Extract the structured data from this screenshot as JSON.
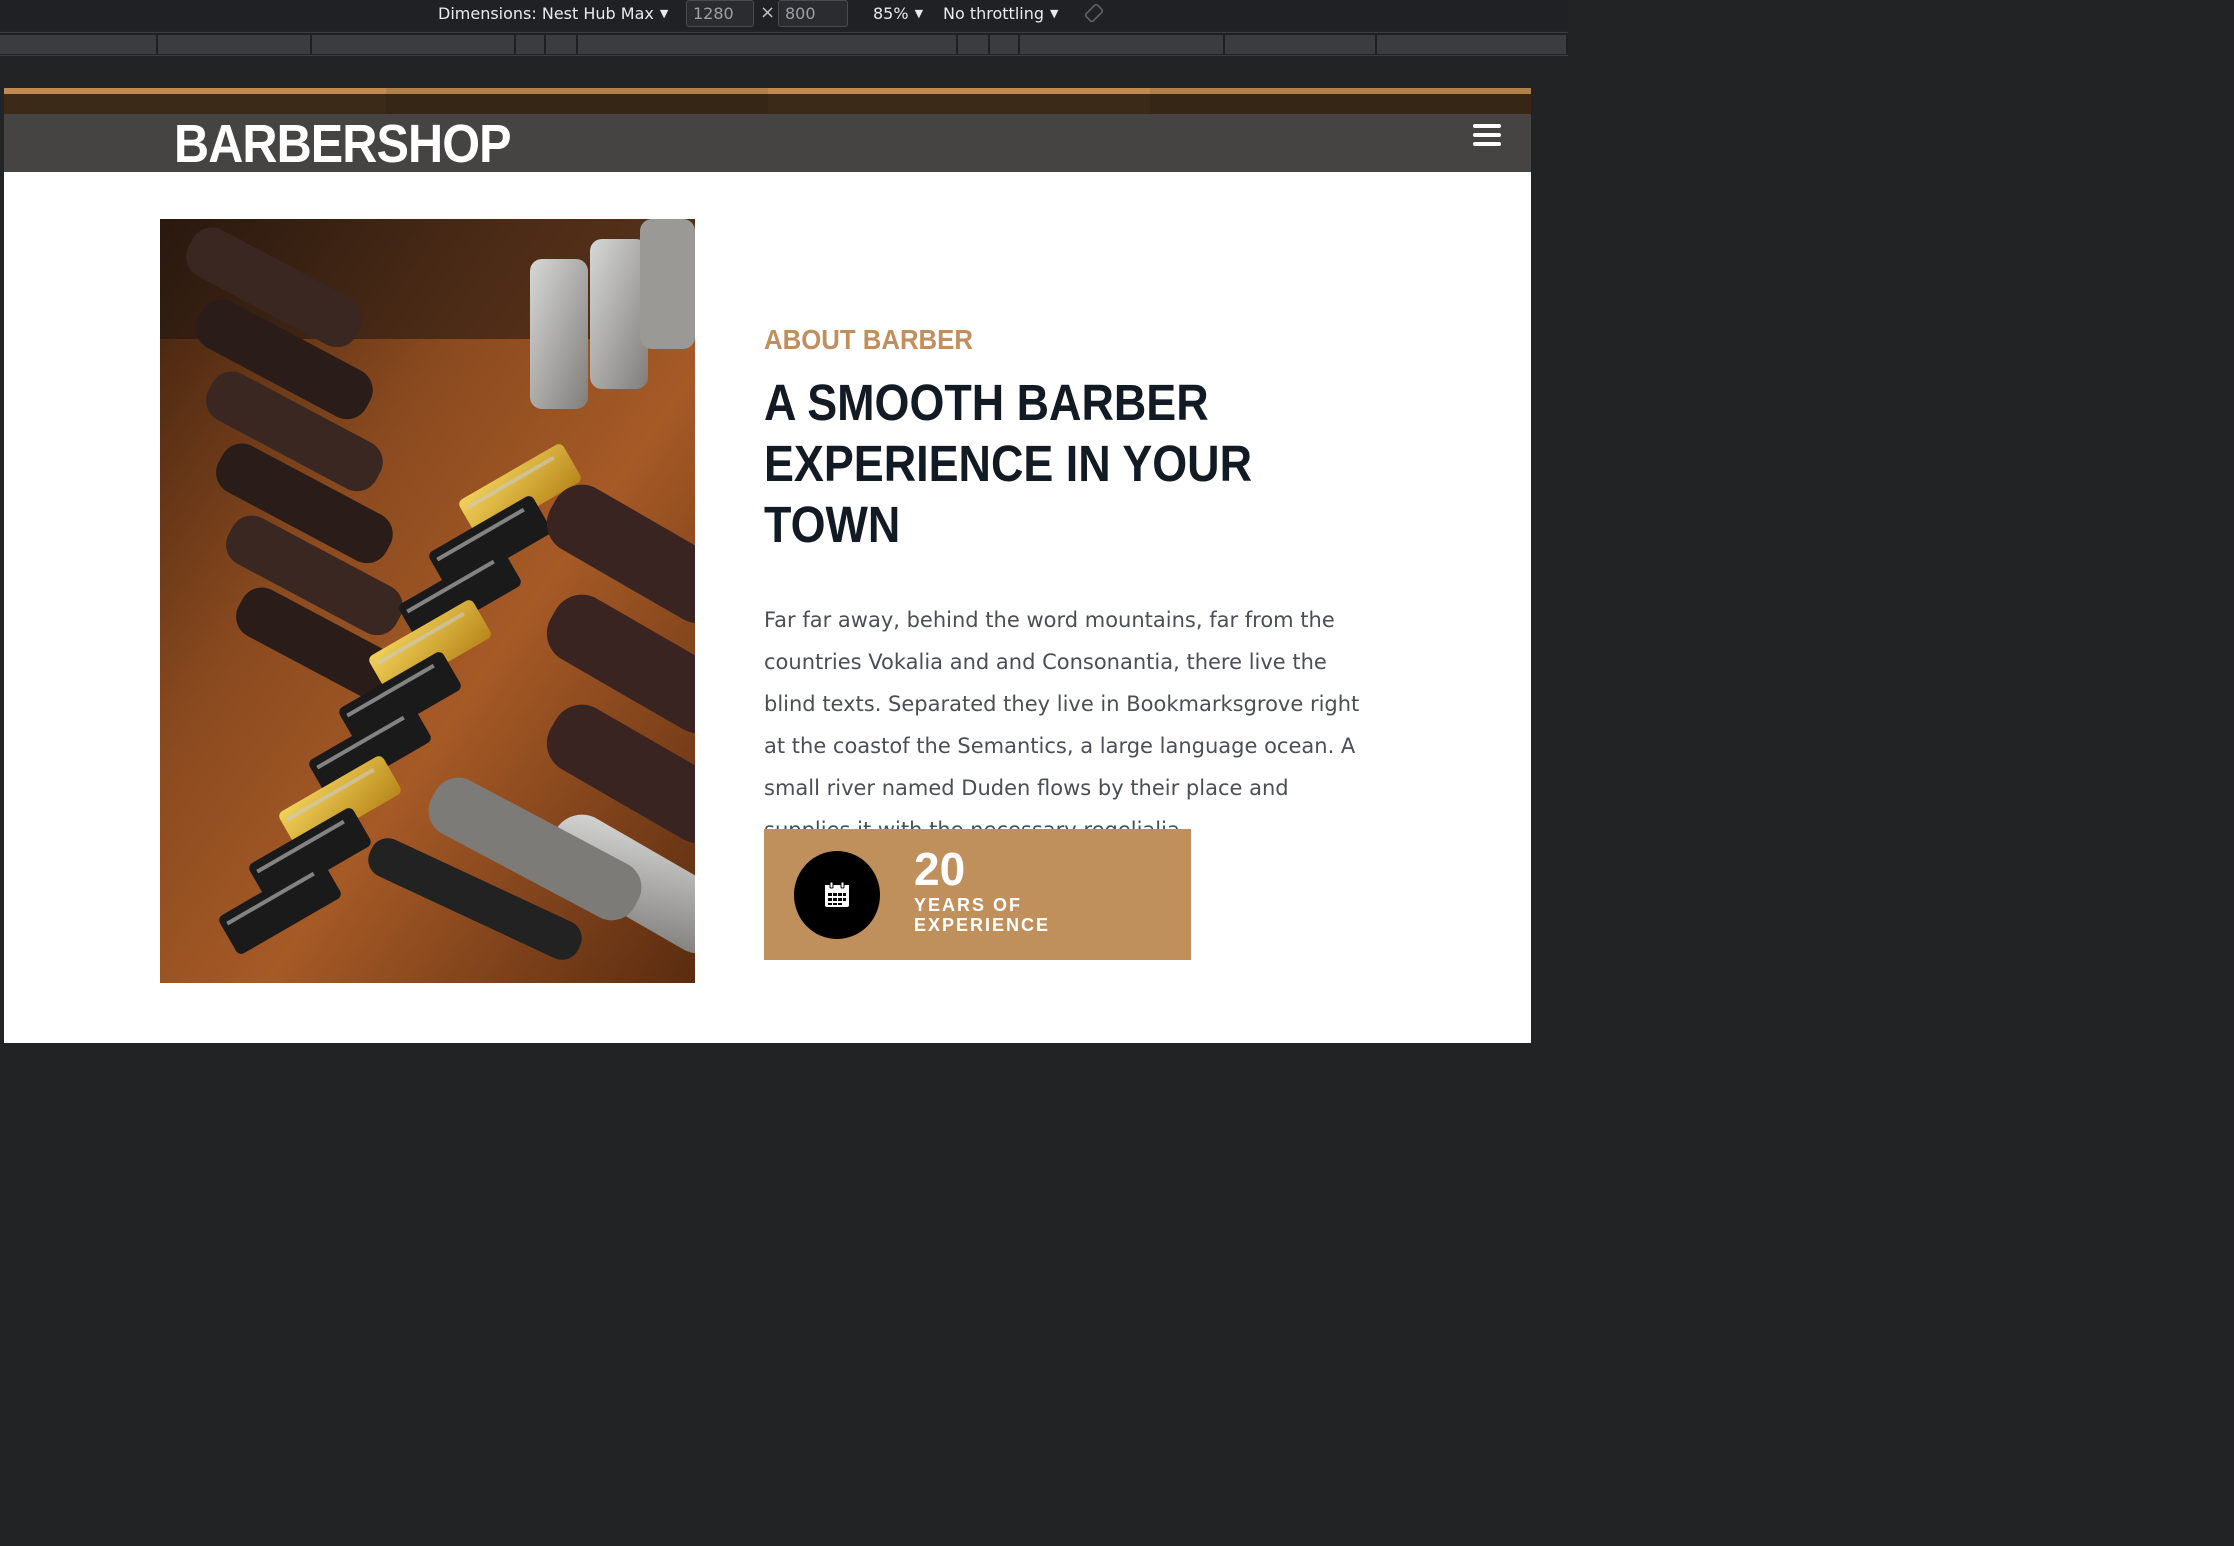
{
  "devtools": {
    "dimensions_label": "Dimensions: Nest Hub Max",
    "width_value": "1280",
    "height_value": "800",
    "times_symbol": "×",
    "zoom": "85%",
    "throttling": "No throttling",
    "caret": "▼"
  },
  "site": {
    "brand": "BARBERSHOP",
    "colors": {
      "accent": "#c0905c",
      "navbar": "#454443",
      "heading": "#121a23"
    }
  },
  "about": {
    "subheading": "ABOUT BARBER",
    "heading": "A SMOOTH BARBER EXPERIENCE IN YOUR TOWN",
    "paragraph": "Far far away, behind the word mountains, far from the countries Vokalia and and Consonantia, there live the blind texts. Separated they live in Bookmarksgrove right at the coastof the Semantics, a large language ocean. A small river named Duden flows by their place and supplies it with the necessary regelialia.",
    "experience": {
      "number": "20",
      "label": "YEARS OF EXPERIENCE",
      "icon": "calendar-icon"
    },
    "photo_icon": "barber-clippers-photo"
  }
}
